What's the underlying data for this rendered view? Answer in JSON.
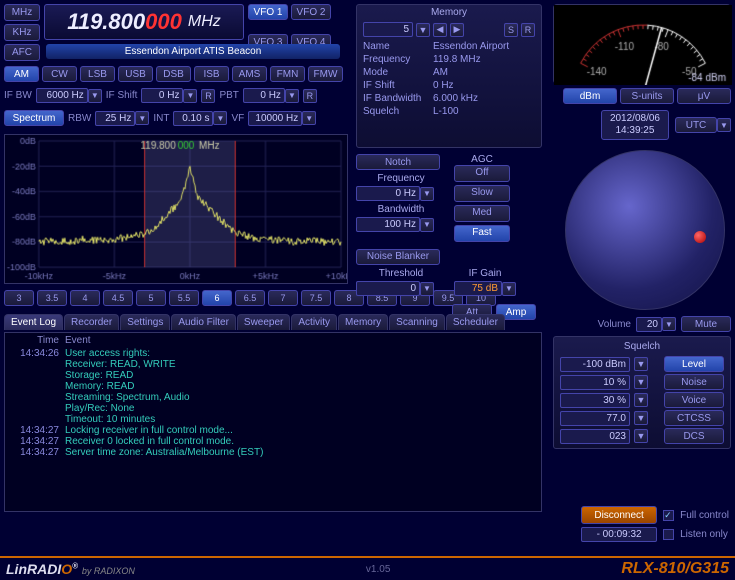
{
  "units": {
    "mhz": "MHz",
    "khz": "KHz",
    "afc": "AFC"
  },
  "frequency": {
    "main": "119.800",
    "decimals": "000",
    "unit": "MHz"
  },
  "vfo": {
    "v1": "VFO 1",
    "v2": "VFO 2",
    "v3": "VFO 3",
    "v4": "VFO 4"
  },
  "description": "Essendon Airport ATIS Beacon",
  "modes": [
    "AM",
    "CW",
    "LSB",
    "USB",
    "DSB",
    "ISB",
    "AMS",
    "FMN",
    "FMW"
  ],
  "active_mode_index": 0,
  "ifbw": {
    "label": "IF BW",
    "value": "6000 Hz"
  },
  "ifshift": {
    "label": "IF Shift",
    "value": "0 Hz",
    "r": "R"
  },
  "pbt": {
    "label": "PBT",
    "value": "0 Hz",
    "r": "R"
  },
  "spectrum_btn": "Spectrum",
  "rbw": {
    "label": "RBW",
    "value": "25 Hz"
  },
  "int": {
    "label": "INT",
    "value": "0.10 s"
  },
  "vf": {
    "label": "VF",
    "value": "10000 Hz"
  },
  "chart_data": {
    "type": "line",
    "title": "119.800000 MHz",
    "xlabel": "",
    "ylabel": "dB",
    "x_ticks": [
      "-10kHz",
      "-5kHz",
      "0kHz",
      "+5kHz",
      "+10kHz"
    ],
    "y_ticks": [
      "0dB",
      "-20dB",
      "-40dB",
      "-60dB",
      "-80dB",
      "-100dB"
    ],
    "xlim": [
      -10,
      10
    ],
    "ylim": [
      -100,
      0
    ],
    "passband": [
      -3,
      3
    ],
    "series": [
      {
        "name": "spectrum",
        "x": [
          -10,
          -9,
          -8,
          -7,
          -6,
          -5,
          -4,
          -3,
          -2.5,
          -2,
          -1.5,
          -1,
          -0.5,
          -0.2,
          0,
          0.2,
          0.5,
          1,
          1.5,
          2,
          2.5,
          3,
          4,
          5,
          6,
          7,
          8,
          9,
          10
        ],
        "y": [
          -80,
          -79,
          -80,
          -78,
          -79,
          -78,
          -76,
          -74,
          -70,
          -64,
          -58,
          -52,
          -44,
          -30,
          -22,
          -30,
          -44,
          -50,
          -56,
          -62,
          -68,
          -72,
          -76,
          -78,
          -79,
          -80,
          -79,
          -80,
          -80
        ]
      }
    ]
  },
  "span_buttons": [
    "3",
    "3.5",
    "4",
    "4.5",
    "5",
    "5.5",
    "6",
    "6.5",
    "7",
    "7.5",
    "8",
    "8.5",
    "9",
    "9.5",
    "10"
  ],
  "span_active_index": 6,
  "memory": {
    "title": "Memory",
    "index": "5",
    "s": "S",
    "r": "R",
    "fields": {
      "Name": "Essendon Airport",
      "Frequency": "119.8 MHz",
      "Mode": "AM",
      "IF Shift": "0 Hz",
      "IF Bandwidth": "6.000 kHz",
      "Squelch": "L-100"
    }
  },
  "notch": {
    "title": "Notch",
    "freq_label": "Frequency",
    "freq": "0 Hz",
    "bw_label": "Bandwidth",
    "bw": "100 Hz"
  },
  "agc": {
    "title": "AGC",
    "options": [
      "Off",
      "Slow",
      "Med",
      "Fast"
    ],
    "active": 3
  },
  "nb": {
    "title": "Noise Blanker",
    "thresh_label": "Threshold",
    "thresh": "0",
    "ifgain_label": "IF Gain",
    "ifgain": "75 dB"
  },
  "att": "Att",
  "amp": "Amp",
  "meter": {
    "scale": [
      "-140",
      "-110",
      "-80",
      "-50"
    ],
    "value": "-84 dBm"
  },
  "meter_buttons": [
    "dBm",
    "S-units",
    "μV"
  ],
  "meter_active": 0,
  "datetime": {
    "date": "2012/08/06",
    "time": "14:39:25",
    "tz": "UTC"
  },
  "volume": {
    "label": "Volume",
    "value": "20"
  },
  "mute": "Mute",
  "tabs": [
    "Event Log",
    "Recorder",
    "Settings",
    "Audio Filter",
    "Sweeper",
    "Activity",
    "Memory",
    "Scanning",
    "Scheduler"
  ],
  "tab_active": 0,
  "eventlog": {
    "head_time": "Time",
    "head_event": "Event",
    "rows": [
      {
        "time": "14:34:26",
        "msg": "User access rights:"
      },
      {
        "time": "",
        "msg": "Receiver: READ, WRITE"
      },
      {
        "time": "",
        "msg": "Storage: READ"
      },
      {
        "time": "",
        "msg": "Memory: READ"
      },
      {
        "time": "",
        "msg": "Streaming: Spectrum, Audio"
      },
      {
        "time": "",
        "msg": "Play/Rec: None"
      },
      {
        "time": "",
        "msg": "Timeout: 10 minutes"
      },
      {
        "time": "14:34:27",
        "msg": "Locking receiver in full control mode..."
      },
      {
        "time": "14:34:27",
        "msg": "Receiver 0 locked in full control mode."
      },
      {
        "time": "14:34:27",
        "msg": "Server time zone: Australia/Melbourne (EST)"
      }
    ]
  },
  "squelch": {
    "title": "Squelch",
    "rows": [
      {
        "value": "-100 dBm",
        "label": "Level",
        "active": true
      },
      {
        "value": "10 %",
        "label": "Noise",
        "active": false
      },
      {
        "value": "30 %",
        "label": "Voice",
        "active": false
      },
      {
        "value": "77.0",
        "label": "CTCSS",
        "active": false
      },
      {
        "value": "023",
        "label": "DCS",
        "active": false
      }
    ]
  },
  "conn": {
    "disconnect": "Disconnect",
    "timer": "- 00:09:32",
    "full": "Full control",
    "listen": "Listen only",
    "full_on": true,
    "listen_on": false
  },
  "footer": {
    "brand": "LinRADIO",
    "by": "by RADIXON",
    "version": "v1.05",
    "model": "RLX-810/G315"
  }
}
